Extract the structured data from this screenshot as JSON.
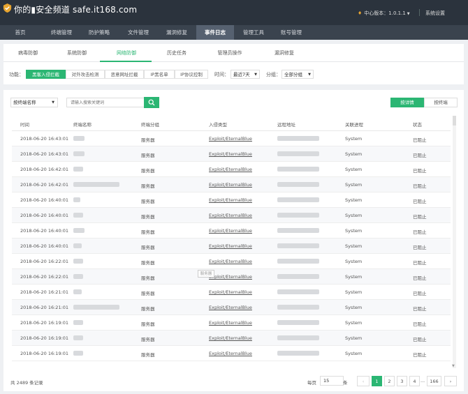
{
  "header": {
    "watermark": "你的▮安全频道 safe.it168.com",
    "version": "中心版本：1.0.1.1",
    "settings": "系统设置"
  },
  "nav": [
    "首页",
    "终端管理",
    "防护策略",
    "文件管理",
    "漏洞修复",
    "事件日志",
    "管理工具",
    "账号管理"
  ],
  "subtabs": [
    "病毒防御",
    "系统防御",
    "网络防御",
    "历史任务",
    "管理员操作",
    "漏洞修复"
  ],
  "filter": {
    "func_label": "功能：",
    "buttons": [
      "黑客入侵拦截",
      "对外攻击检测",
      "恶意网址拦截",
      "IP黑名单",
      "IP协议控制"
    ],
    "time_label": "时间：",
    "time_value": "最近7天",
    "group_label": "分组：",
    "group_value": "全部分组"
  },
  "search": {
    "select_value": "按终端名称",
    "placeholder": "请输入搜索关键词",
    "view_detail": "按详情",
    "view_terminal": "按终端"
  },
  "table": {
    "columns": [
      "时间",
      "终端名称",
      "终端分组",
      "入侵类型",
      "远程地址",
      "关联进程",
      "状态"
    ],
    "rows": [
      {
        "time": "2018-06-20 16:43:01",
        "group": "服务器",
        "type": "Exploit/EternalBlue",
        "process": "System",
        "status": "已阻止"
      },
      {
        "time": "2018-06-20 16:43:01",
        "group": "服务器",
        "type": "Exploit/EternalBlue",
        "process": "System",
        "status": "已阻止"
      },
      {
        "time": "2018-06-20 16:42:01",
        "group": "服务器",
        "type": "Exploit/EternalBlue",
        "process": "System",
        "status": "已阻止"
      },
      {
        "time": "2018-06-20 16:42:01",
        "group": "服务器",
        "type": "Exploit/EternalBlue",
        "process": "System",
        "status": "已阻止"
      },
      {
        "time": "2018-06-20 16:40:01",
        "group": "服务器",
        "type": "Exploit/EternalBlue",
        "process": "System",
        "status": "已阻止"
      },
      {
        "time": "2018-06-20 16:40:01",
        "group": "服务器",
        "type": "Exploit/EternalBlue",
        "process": "System",
        "status": "已阻止"
      },
      {
        "time": "2018-06-20 16:40:01",
        "group": "服务器",
        "type": "Exploit/EternalBlue",
        "process": "System",
        "status": "已阻止"
      },
      {
        "time": "2018-06-20 16:40:01",
        "group": "服务器",
        "type": "Exploit/EternalBlue",
        "process": "System",
        "status": "已阻止"
      },
      {
        "time": "2018-06-20 16:22:01",
        "group": "服务器",
        "type": "Exploit/EternalBlue",
        "process": "System",
        "status": "已阻止"
      },
      {
        "time": "2018-06-20 16:22:01",
        "group": "服务器",
        "type": "Exploit/EternalBlue",
        "process": "System",
        "status": "已阻止"
      },
      {
        "time": "2018-06-20 16:21:01",
        "group": "服务器",
        "type": "Exploit/EternalBlue",
        "process": "System",
        "status": "已阻止"
      },
      {
        "time": "2018-06-20 16:21:01",
        "group": "服务器",
        "type": "Exploit/EternalBlue",
        "process": "System",
        "status": "已阻止"
      },
      {
        "time": "2018-06-20 16:19:01",
        "group": "服务器",
        "type": "Exploit/EternalBlue",
        "process": "System",
        "status": "已阻止"
      },
      {
        "time": "2018-06-20 16:19:01",
        "group": "服务器",
        "type": "Exploit/EternalBlue",
        "process": "System",
        "status": "已阻止"
      },
      {
        "time": "2018-06-20 16:19:01",
        "group": "服务器",
        "type": "Exploit/EternalBlue",
        "process": "System",
        "status": "已阻止"
      }
    ],
    "tooltip": "服务器"
  },
  "pagination": {
    "total": "共 2489 条记录",
    "per_page_label": "每页",
    "per_page": "15",
    "unit": "条",
    "prev": "‹",
    "pages": [
      "1",
      "2",
      "3",
      "4"
    ],
    "ellipsis": "...",
    "last": "166",
    "next": "›"
  },
  "colors": {
    "accent": "#2bb673",
    "topbar": "#2b333d",
    "nav": "#3a434e",
    "nav_active": "#566170"
  },
  "icons": {
    "logo": "shield-logo-icon",
    "version": "flame-icon",
    "search": "search-icon",
    "dropdown": "chevron-down-icon"
  }
}
